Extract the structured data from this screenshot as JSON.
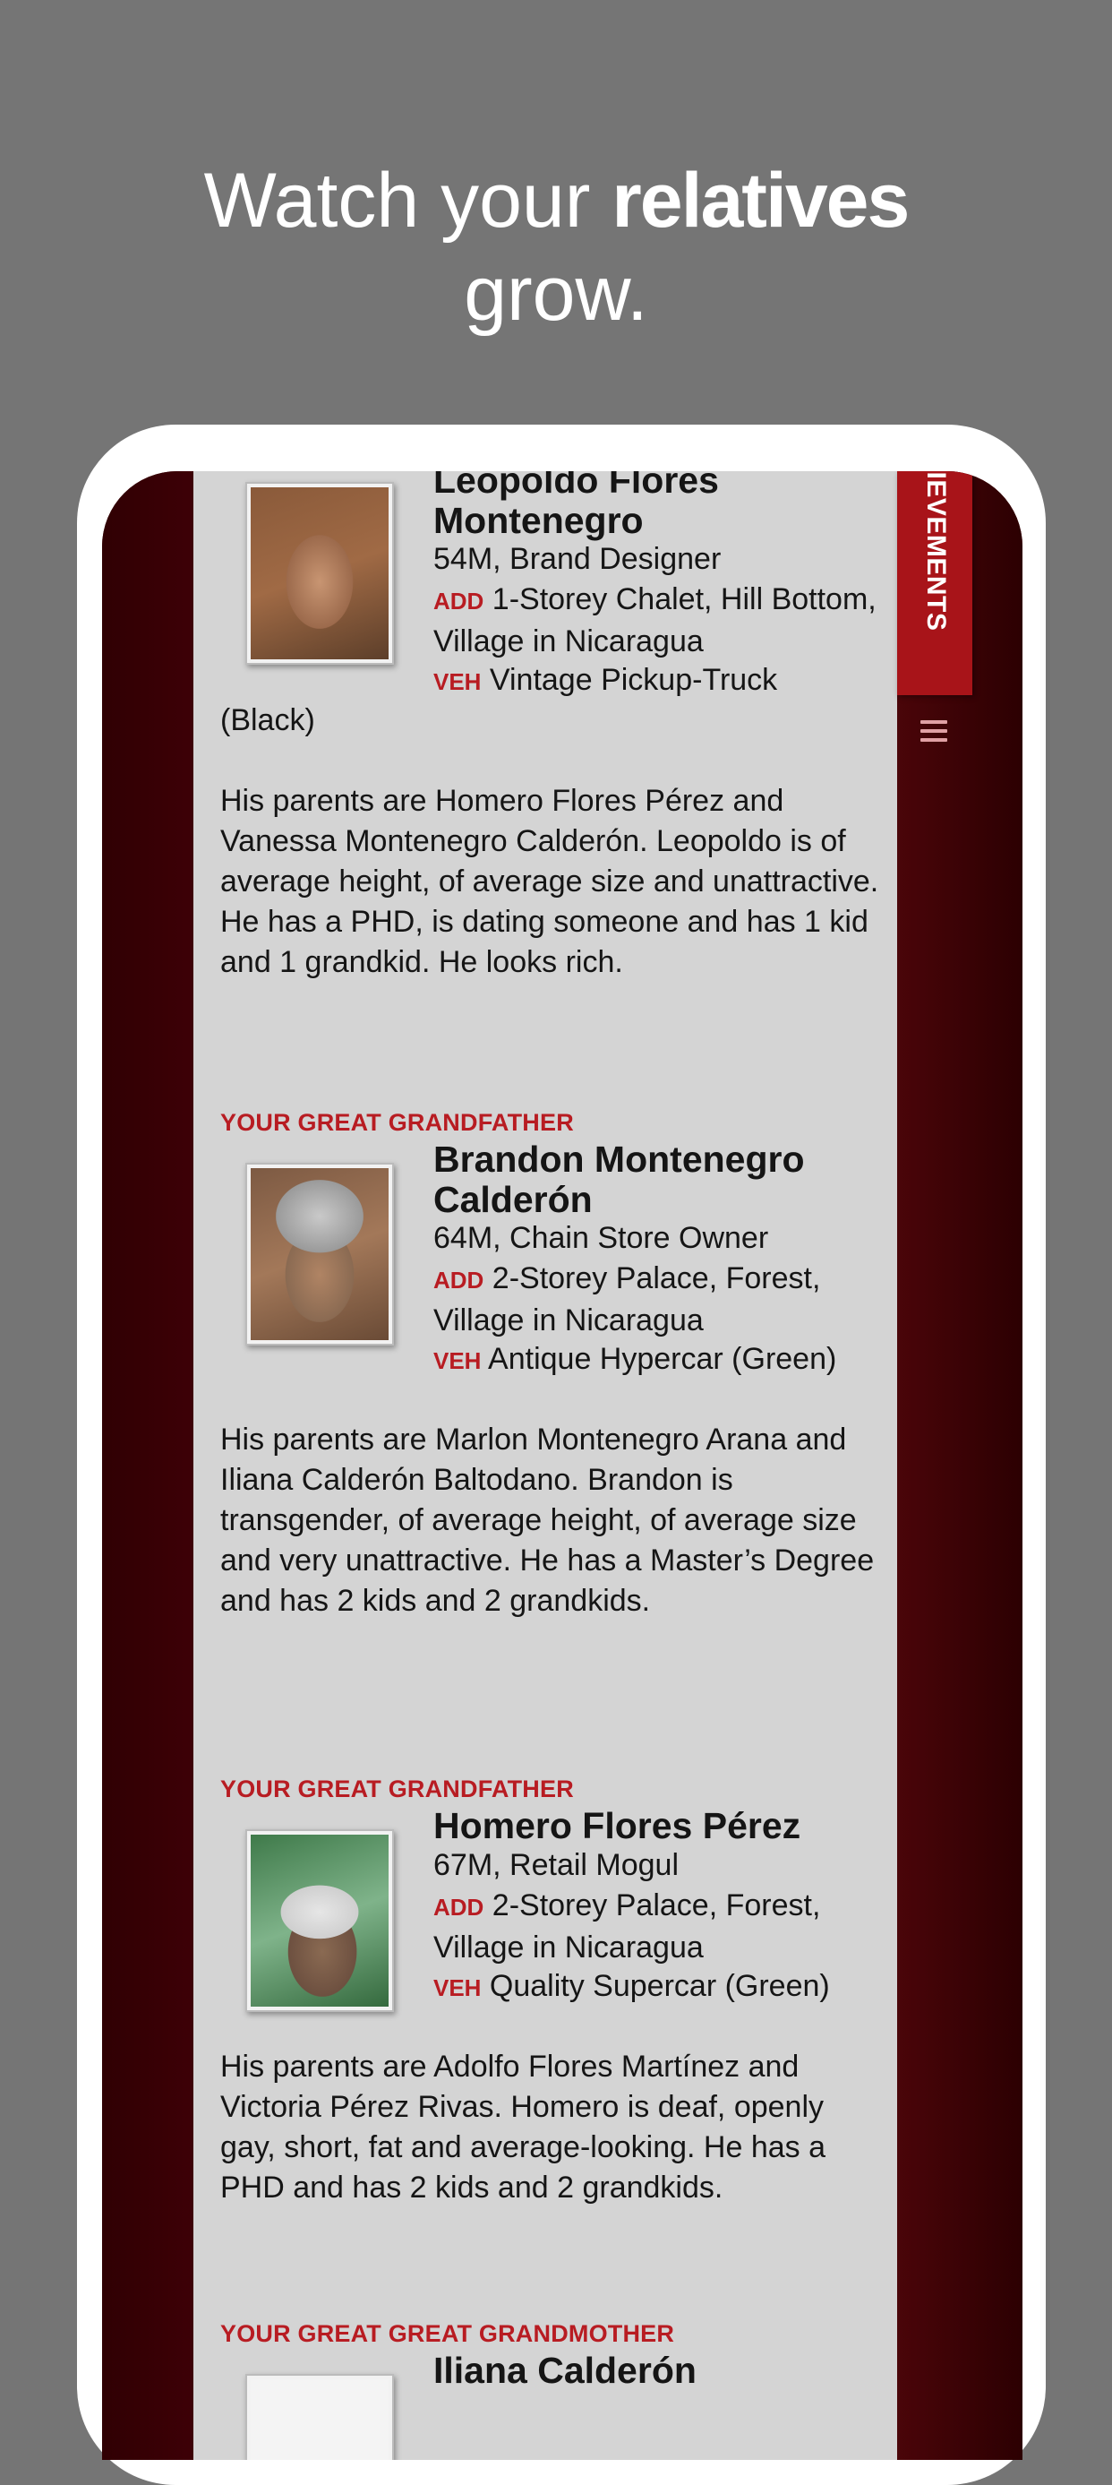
{
  "headline": {
    "line1_pre": "Watch your ",
    "line1_bold": "relatives",
    "line2": "grow."
  },
  "sidebar_tab": {
    "label": "ACHIEVEMENTS",
    "menu_icon": "hamburger-icon"
  },
  "colors": {
    "accent": "#b81c22",
    "background": "#757575",
    "panel": "#d4d4d4",
    "frame": "#3a0004"
  },
  "labels": {
    "address_tag": "ADD",
    "vehicle_tag": "VEH"
  },
  "relatives": [
    {
      "relation": "",
      "name": "Leopoldo Flores Montenegro",
      "age_job": "54M, Brand Designer",
      "address": "1-Storey Chalet, Hill Bottom, Village in Nicaragua",
      "vehicle": "Vintage Pickup-Truck",
      "vehicle_wrap": "(Black)",
      "bio": "His parents are Homero Flores Pérez and Vanessa Montenegro Calderón. Leopoldo is of average height, of average size and unattractive. He has a PHD, is dating someone and has 1 kid and 1 grandkid. He looks rich."
    },
    {
      "relation": "YOUR GREAT GRANDFATHER",
      "name": "Brandon Montenegro Calderón",
      "age_job": "64M, Chain Store Owner",
      "address": "2-Storey Palace, Forest, Village in Nicaragua",
      "vehicle": "Antique Hypercar (Green)",
      "bio": "His parents are Marlon Montenegro Arana and Iliana Calderón Baltodano. Brandon is transgender, of average height, of average size and very unattractive. He has a Master’s Degree and has 2 kids and 2 grandkids."
    },
    {
      "relation": "YOUR GREAT GRANDFATHER",
      "name": "Homero Flores Pérez",
      "age_job": "67M, Retail Mogul",
      "address": "2-Storey Palace, Forest, Village in Nicaragua",
      "vehicle": "Quality Supercar (Green)",
      "bio": "His parents are Adolfo Flores Martínez and Victoria Pérez Rivas. Homero is deaf, openly gay, short, fat and average-looking. He has a PHD and has 2 kids and 2 grandkids."
    },
    {
      "relation": "YOUR GREAT GREAT GRANDMOTHER",
      "name": "Iliana Calderón"
    }
  ]
}
